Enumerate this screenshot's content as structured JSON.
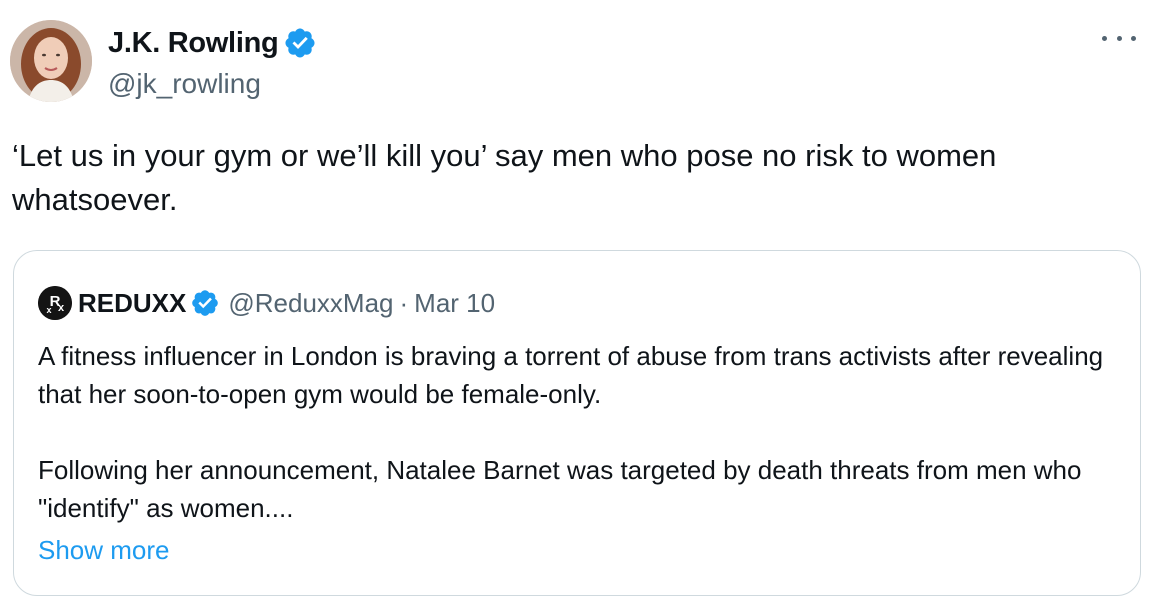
{
  "tweet": {
    "author": {
      "display_name": "J.K. Rowling",
      "handle": "@jk_rowling",
      "verified": true,
      "verified_color": "#1d9bf0"
    },
    "text": "‘Let us in your gym or we’ll kill you’ say men who pose no risk to women whatsoever.",
    "more_icon": "ellipsis-icon"
  },
  "quote": {
    "author": {
      "display_name": "REDUXX",
      "handle": "@ReduxxMag",
      "separator": "·",
      "date": "Mar 10",
      "verified": true
    },
    "paragraphs": [
      "A fitness influencer in London is braving a torrent of abuse from trans activists after revealing that her soon-to-open gym would be female-only.",
      "Following her announcement, Natalee Barnet was targeted by death threats from men who \"identify\" as women...."
    ],
    "show_more": "Show more"
  },
  "colors": {
    "text_primary": "#0f1419",
    "text_secondary": "#536471",
    "link": "#1d9bf0",
    "border": "#cfd9de"
  }
}
